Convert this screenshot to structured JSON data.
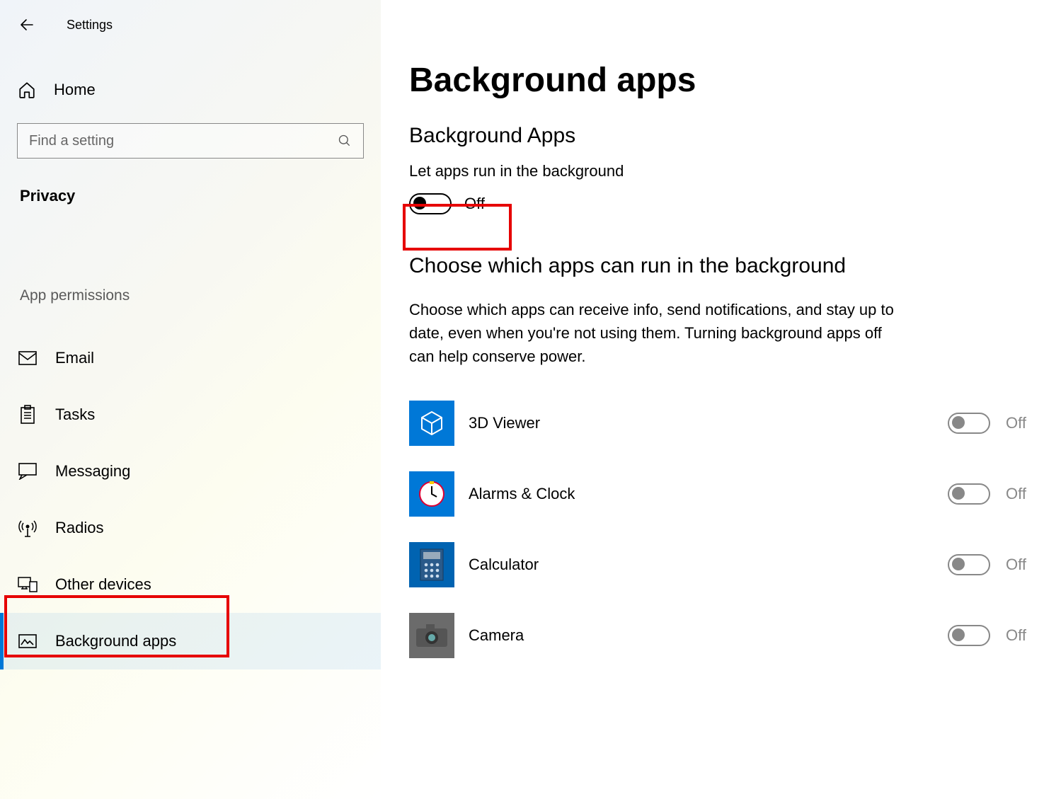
{
  "window": {
    "title": "Settings"
  },
  "sidebar": {
    "home_label": "Home",
    "search_placeholder": "Find a setting",
    "category_label": "Privacy",
    "subcategory_label": "App permissions",
    "items": [
      {
        "label": "Email",
        "icon": "email-icon"
      },
      {
        "label": "Tasks",
        "icon": "tasks-icon"
      },
      {
        "label": "Messaging",
        "icon": "messaging-icon"
      },
      {
        "label": "Radios",
        "icon": "radios-icon"
      },
      {
        "label": "Other devices",
        "icon": "other-devices-icon"
      },
      {
        "label": "Background apps",
        "icon": "background-apps-icon",
        "active": true
      }
    ]
  },
  "main": {
    "title": "Background apps",
    "section_title": "Background Apps",
    "master_toggle_label": "Let apps run in the background",
    "master_toggle_state": "Off",
    "choose_heading": "Choose which apps can run in the background",
    "choose_desc_line1": "Choose which apps can receive info, send notifications, and stay up to",
    "choose_desc_line2": "date, even when you're not using them. Turning background apps off",
    "choose_desc_line3": "can help conserve power.",
    "apps": [
      {
        "name": "3D Viewer",
        "state": "Off",
        "icon": "cube-icon"
      },
      {
        "name": "Alarms & Clock",
        "state": "Off",
        "icon": "clock-icon"
      },
      {
        "name": "Calculator",
        "state": "Off",
        "icon": "calculator-icon"
      },
      {
        "name": "Camera",
        "state": "Off",
        "icon": "camera-icon"
      }
    ]
  },
  "colors": {
    "accent": "#0078d7",
    "highlight": "#e60000"
  }
}
